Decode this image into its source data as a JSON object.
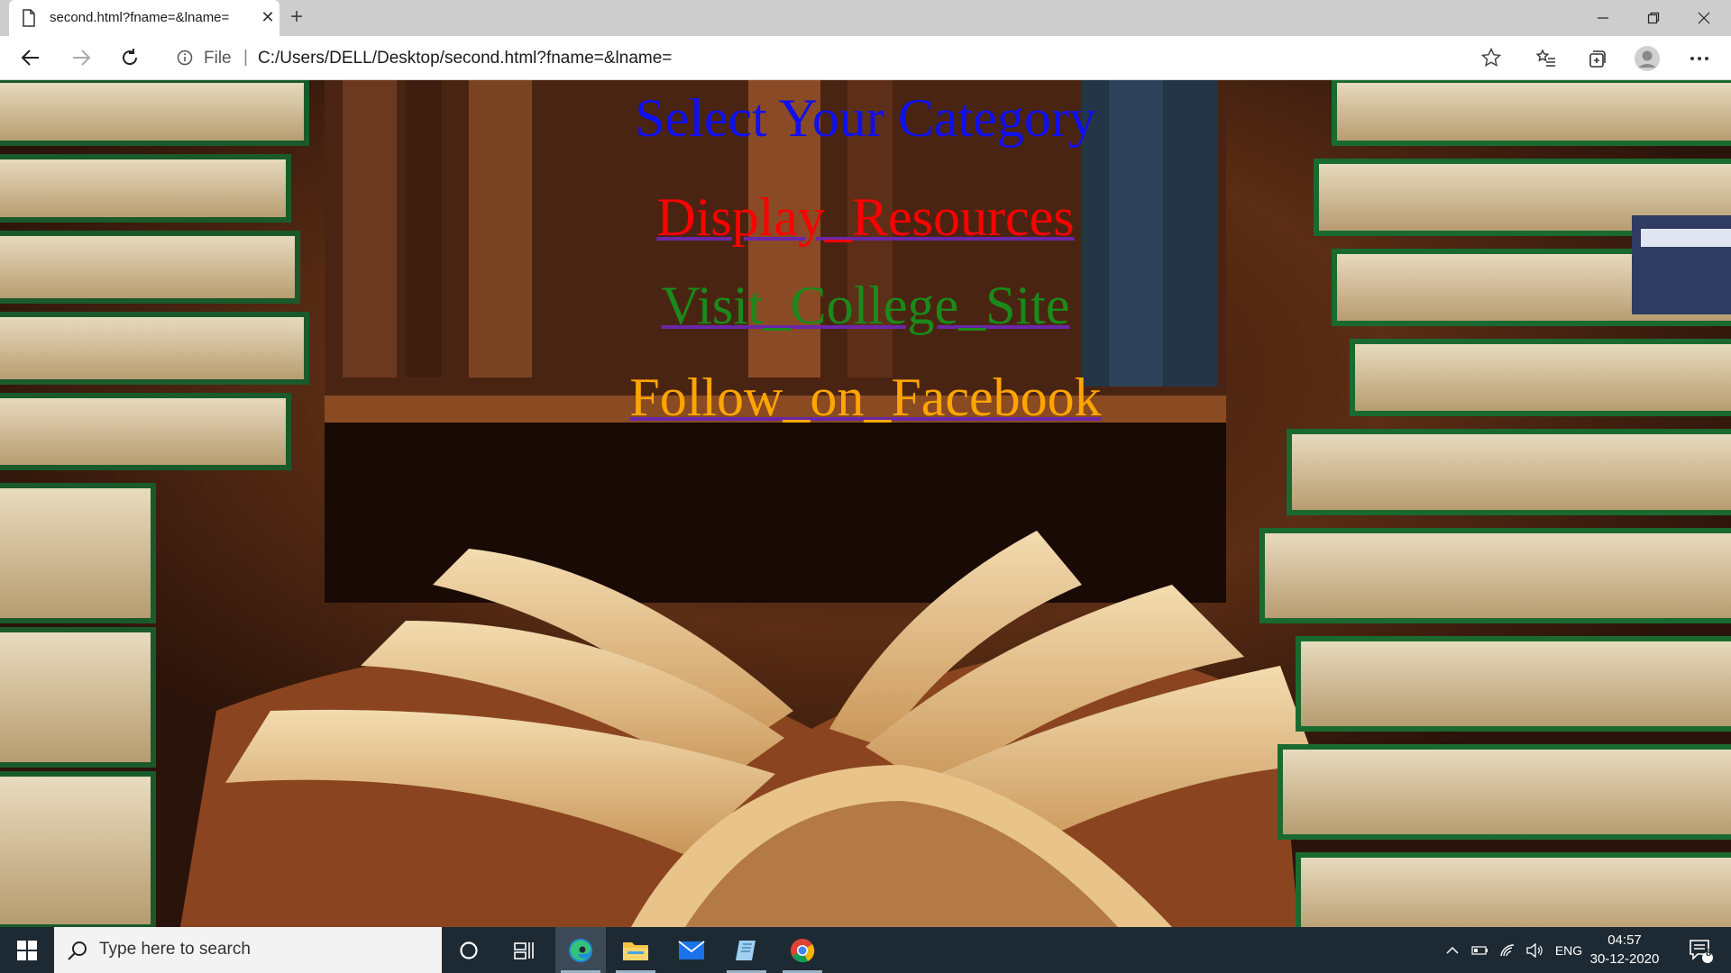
{
  "browser": {
    "tab": {
      "title": "second.html?fname=&lname="
    },
    "address": {
      "scheme_label": "File",
      "url": "C:/Users/DELL/Desktop/second.html?fname=&lname="
    }
  },
  "page": {
    "heading": "Select Your Category",
    "links": [
      {
        "label": "Display_Resources",
        "color": "#ff0000"
      },
      {
        "label": "Visit_College_Site",
        "color": "#1a8a1a"
      },
      {
        "label": "Follow_on_Facebook",
        "color": "#ffa500"
      }
    ]
  },
  "taskbar": {
    "search_placeholder": "Type here to search",
    "tray_language": "ENG",
    "time": "04:57",
    "date": "30-12-2020",
    "notification_count": "8"
  },
  "colors": {
    "heading": "#0f0ff0",
    "underline": "#6a28a8"
  }
}
